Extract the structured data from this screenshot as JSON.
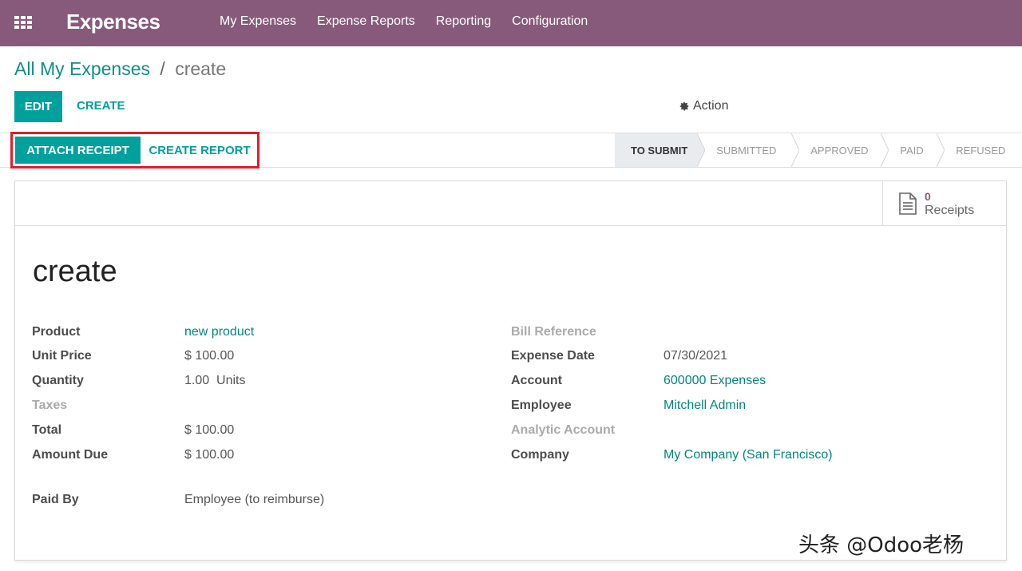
{
  "navbar": {
    "brand": "Expenses",
    "menu": [
      "My Expenses",
      "Expense Reports",
      "Reporting",
      "Configuration"
    ]
  },
  "breadcrumb": {
    "parent": "All My Expenses",
    "separator": "/",
    "current": "create"
  },
  "control_panel": {
    "edit_label": "EDIT",
    "create_label": "CREATE",
    "action_label": "Action"
  },
  "statusbar": {
    "attach_receipt_label": "ATTACH RECEIPT",
    "create_report_label": "CREATE REPORT",
    "stages": [
      "TO SUBMIT",
      "SUBMITTED",
      "APPROVED",
      "PAID",
      "REFUSED"
    ],
    "active_stage": "TO SUBMIT"
  },
  "receipts": {
    "count": "0",
    "label": "Receipts"
  },
  "form": {
    "title": "create",
    "left": [
      {
        "label": "Product",
        "value": "new product",
        "link": true,
        "muted": false
      },
      {
        "label": "Unit Price",
        "value": "$ 100.00",
        "link": false,
        "muted": false
      },
      {
        "label": "Quantity",
        "value": "1.00  Units",
        "link": false,
        "muted": false
      },
      {
        "label": "Taxes",
        "value": "",
        "link": false,
        "muted": true
      },
      {
        "label": "Total",
        "value": "$ 100.00",
        "link": false,
        "muted": false
      },
      {
        "label": "Amount Due",
        "value": "$ 100.00",
        "link": false,
        "muted": false
      }
    ],
    "paid_by": {
      "label": "Paid By",
      "value": "Employee (to reimburse)"
    },
    "right": [
      {
        "label": "Bill Reference",
        "value": "",
        "link": false,
        "muted": true
      },
      {
        "label": "Expense Date",
        "value": "07/30/2021",
        "link": false,
        "muted": false
      },
      {
        "label": "Account",
        "value": "600000 Expenses",
        "link": true,
        "muted": false
      },
      {
        "label": "Employee",
        "value": "Mitchell Admin",
        "link": true,
        "muted": false
      },
      {
        "label": "Analytic Account",
        "value": "",
        "link": false,
        "muted": true
      },
      {
        "label": "Company",
        "value": "My Company (San Francisco)",
        "link": true,
        "muted": false
      }
    ]
  },
  "watermark": "头条 @Odoo老杨",
  "colors": {
    "navbar": "#875a7b",
    "primary": "#00a09d",
    "highlight": "#e21d2c"
  }
}
